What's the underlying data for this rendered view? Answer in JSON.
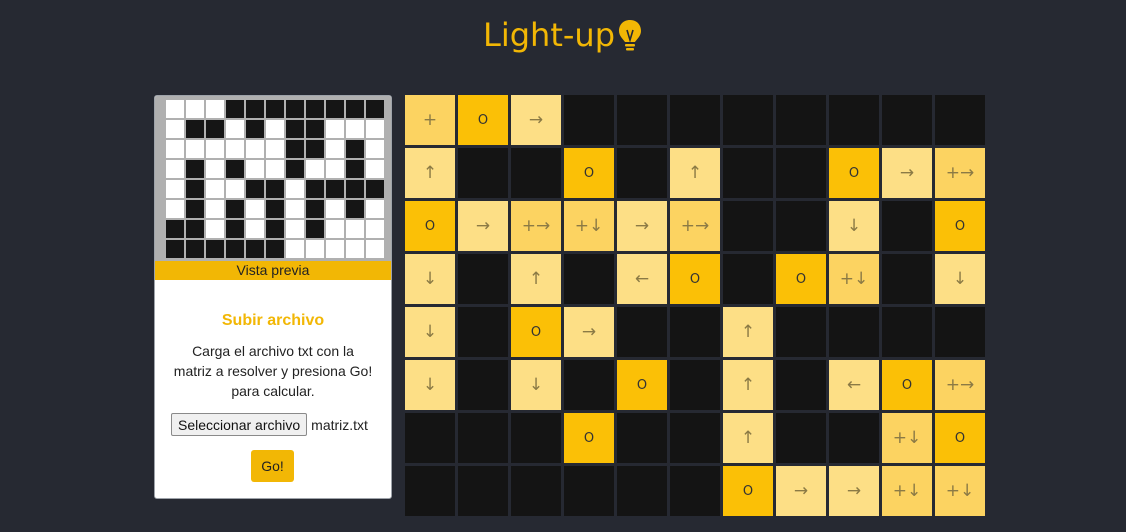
{
  "header": {
    "title": "Light-up",
    "icon": "lightbulb-icon",
    "accent": "#f2b705"
  },
  "sidebar": {
    "preview_label": "Vista previa",
    "upload_title": "Subir archivo",
    "upload_description": "Carga el archivo txt con la matriz a resolver y presiona Go! para calcular.",
    "file_button": "Seleccionar archivo",
    "file_name": "matriz.txt",
    "go_label": "Go!",
    "preview_grid": [
      "wwwbbbbbbbb",
      "wbbwbwbbwww",
      "wwwwwwbbwbw",
      "wbwbwwbwwbw",
      "wbwwbbwbbbb",
      "wbwbwbwbwbw",
      "bbwbwbwbwww",
      "bbbbbbwwwww"
    ]
  },
  "board": {
    "colors": {
      "black": "#141414",
      "lit": "#fddf86",
      "light": "#fbc006",
      "crossed": "#fcd361"
    },
    "rows": [
      [
        "+",
        "O",
        "→",
        "#",
        "#",
        "#",
        "#",
        "#",
        "#",
        "#",
        "#"
      ],
      [
        "↑",
        "#",
        "#",
        "O",
        "#",
        "↑",
        "#",
        "#",
        "O",
        "→",
        "+→"
      ],
      [
        "O",
        "→",
        "+→",
        "+↓",
        "→",
        "+→",
        "#",
        "#",
        "↓",
        "#",
        "O"
      ],
      [
        "↓",
        "#",
        "↑",
        "#",
        "←",
        "O",
        "#",
        "O",
        "+↓",
        "#",
        "↓"
      ],
      [
        "↓",
        "#",
        "O",
        "→",
        "#",
        "#",
        "↑",
        "#",
        "#",
        "#",
        "#"
      ],
      [
        "↓",
        "#",
        "↓",
        "#",
        "O",
        "#",
        "↑",
        "#",
        "←",
        "O",
        "+→"
      ],
      [
        "#",
        "#",
        "#",
        "O",
        "#",
        "#",
        "↑",
        "#",
        "#",
        "+↓",
        "O"
      ],
      [
        "#",
        "#",
        "#",
        "#",
        "#",
        "#",
        "O",
        "→",
        "→",
        "+↓",
        "+↓"
      ]
    ]
  }
}
